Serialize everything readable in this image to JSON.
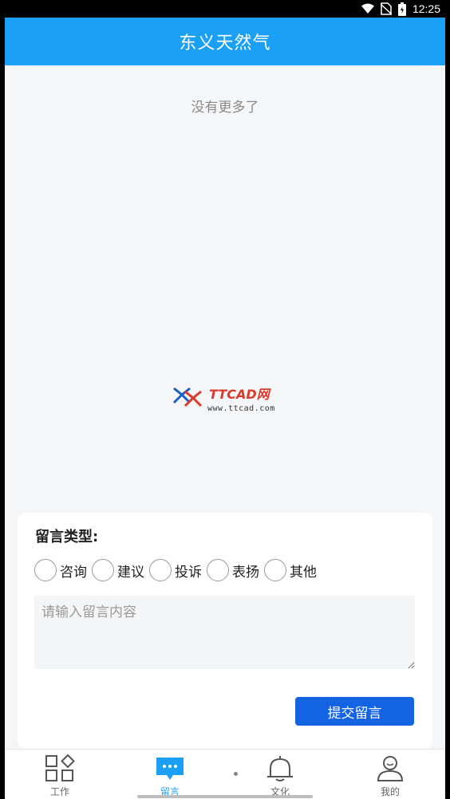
{
  "status_bar": {
    "time": "12:25"
  },
  "header": {
    "title": "东义天然气"
  },
  "list": {
    "empty_text": "没有更多了"
  },
  "watermark": {
    "url": "www.ttcad.com"
  },
  "form": {
    "type_title": "留言类型:",
    "types": [
      "咨询",
      "建议",
      "投诉",
      "表扬",
      "其他"
    ],
    "message_placeholder": "请输入留言内容",
    "submit_label": "提交留言"
  },
  "tabbar": {
    "active": 1,
    "items": [
      {
        "label": "工作",
        "icon": "grid-icon"
      },
      {
        "label": "留言",
        "icon": "chat-bubble-icon"
      },
      {
        "label": "文化",
        "icon": "bell-icon"
      },
      {
        "label": "我的",
        "icon": "user-icon"
      }
    ]
  },
  "colors": {
    "primary": "#1ba0f5",
    "button": "#1463e3",
    "background": "#f5f6f8"
  }
}
